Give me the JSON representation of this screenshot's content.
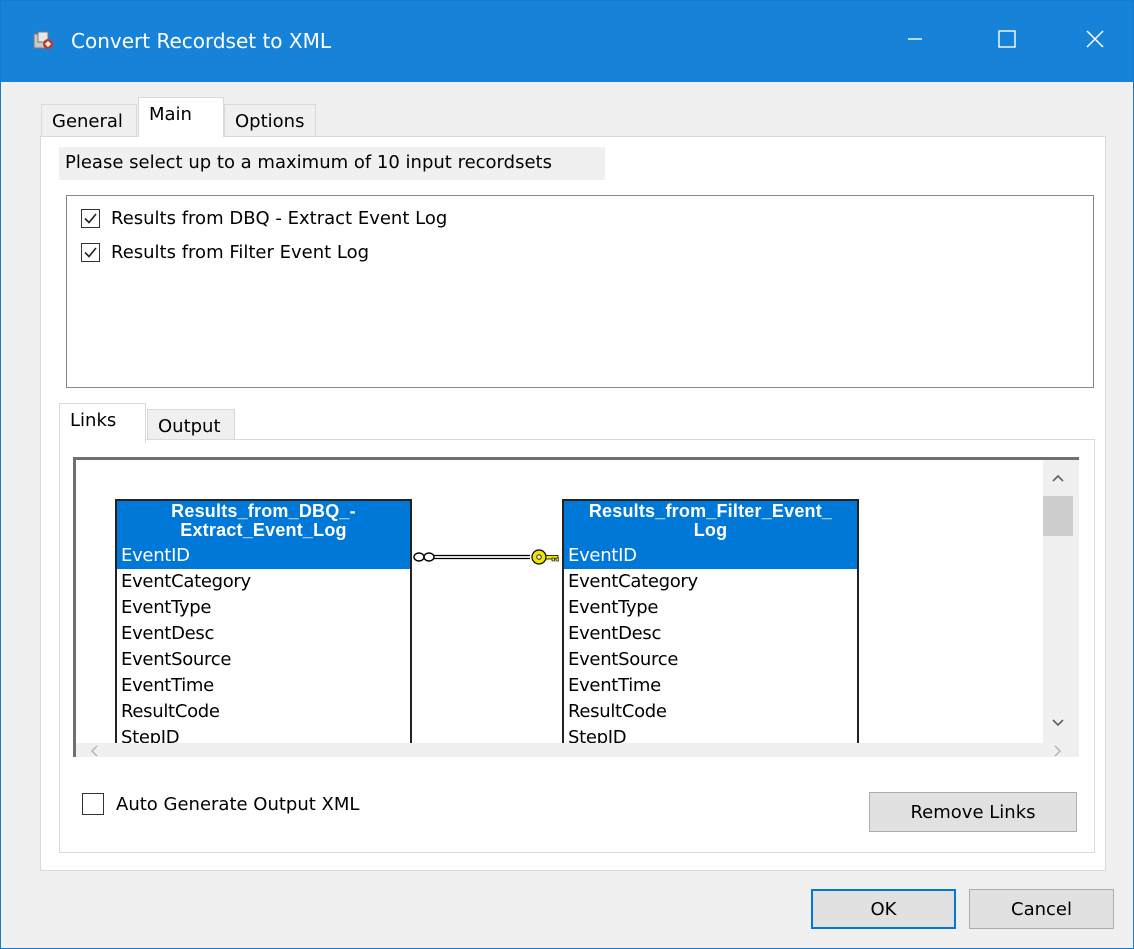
{
  "window": {
    "title": "Convert Recordset to XML",
    "accent": "#1783d8"
  },
  "tabs": [
    {
      "label": "General"
    },
    {
      "label": "Main"
    },
    {
      "label": "Options"
    }
  ],
  "main": {
    "instruction": "Please select up to a maximum of 10 input recordsets",
    "recordsets": [
      {
        "label": "Results from DBQ - Extract Event Log",
        "checked": true
      },
      {
        "label": "Results from Filter Event Log",
        "checked": true
      }
    ]
  },
  "lower_tabs": [
    {
      "label": "Links"
    },
    {
      "label": "Output"
    }
  ],
  "links": {
    "left_table": {
      "title_line1": "Results_from_DBQ_-",
      "title_line2": "Extract_Event_Log",
      "fields": [
        "EventID",
        "EventCategory",
        "EventType",
        "EventDesc",
        "EventSource",
        "EventTime",
        "ResultCode",
        "StepID"
      ]
    },
    "right_table": {
      "title_line1": "Results_from_Filter_Event_",
      "title_line2": "Log",
      "fields": [
        "EventID",
        "EventCategory",
        "EventType",
        "EventDesc",
        "EventSource",
        "EventTime",
        "ResultCode",
        "StepID"
      ]
    },
    "selected_field": "EventID",
    "auto_generate_label": "Auto Generate Output XML",
    "auto_generate_checked": false,
    "remove_links_label": "Remove Links"
  },
  "buttons": {
    "ok": "OK",
    "cancel": "Cancel"
  },
  "colors": {
    "selection": "#0078d7",
    "key_icon": "#f2e600"
  }
}
